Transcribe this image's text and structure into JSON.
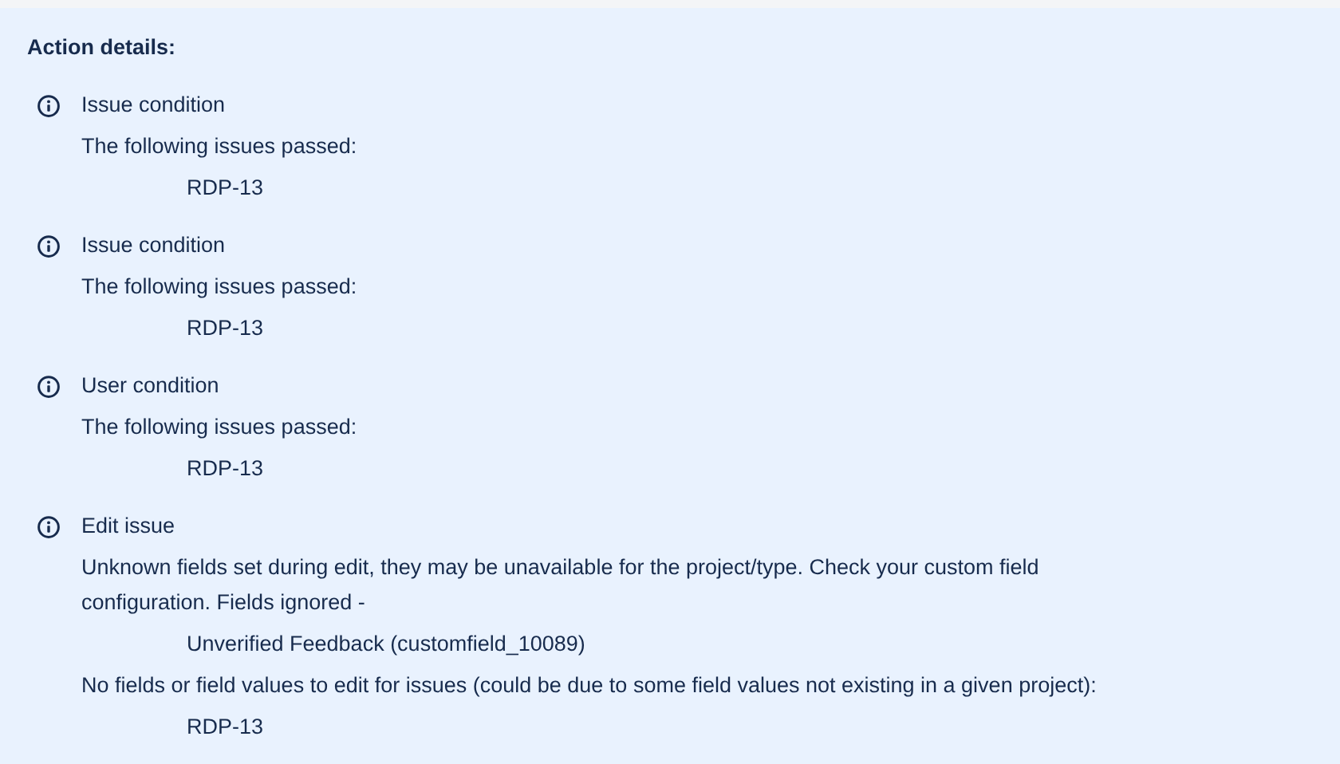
{
  "heading": "Action details:",
  "entries": [
    {
      "title": "Issue condition",
      "details": [
        {
          "message": "The following issues passed:",
          "items": [
            "RDP-13"
          ]
        }
      ]
    },
    {
      "title": "Issue condition",
      "details": [
        {
          "message": "The following issues passed:",
          "items": [
            "RDP-13"
          ]
        }
      ]
    },
    {
      "title": "User condition",
      "details": [
        {
          "message": "The following issues passed:",
          "items": [
            "RDP-13"
          ]
        }
      ]
    },
    {
      "title": "Edit issue",
      "details": [
        {
          "message": "Unknown fields set during edit, they may be unavailable for the project/type. Check your custom field configuration. Fields ignored -",
          "items": [
            "Unverified Feedback (customfield_10089)"
          ]
        },
        {
          "message": "No fields or field values to edit for issues (could be due to some field values not existing in a given project):",
          "items": [
            "RDP-13"
          ]
        }
      ]
    }
  ]
}
